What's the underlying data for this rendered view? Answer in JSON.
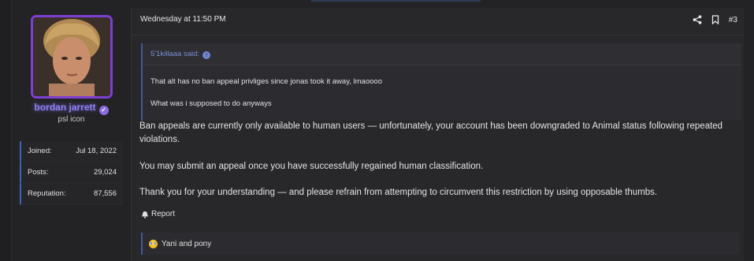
{
  "user": {
    "name": "bordan jarrett",
    "title": "psl icon",
    "stats": [
      {
        "label": "Joined:",
        "value": "Jul 18, 2022"
      },
      {
        "label": "Posts:",
        "value": "29,024"
      },
      {
        "label": "Reputation:",
        "value": "87,556"
      }
    ],
    "accent_color": "#7d3fd1"
  },
  "post": {
    "date": "Wednesday at 11:50 PM",
    "number": "#3",
    "quote": {
      "author": "5'1killaaa said:",
      "lines": [
        "That alt has no ban appeal privliges since jonas took it away, lmaoooo",
        "What was i supposed to do anyways"
      ]
    },
    "paragraphs": [
      "Ban appeals are currently only available to human users — unfortunately, your account has been downgraded to Animal status following repeated violations.",
      "You may submit an appeal once you have successfully regained human classification.",
      "Thank you for your understanding — and please refrain from attempting to circumvent this restriction by using opposable thumbs."
    ],
    "report_label": "Report",
    "reactions_text": "Yani and pony",
    "icons": {
      "share": "share-icon",
      "bookmark": "bookmark-icon",
      "report": "bell-icon",
      "reaction": "laughing-emoji-icon",
      "verified": "verified-badge-icon",
      "quote_jump": "arrow-up-circle-icon"
    }
  }
}
